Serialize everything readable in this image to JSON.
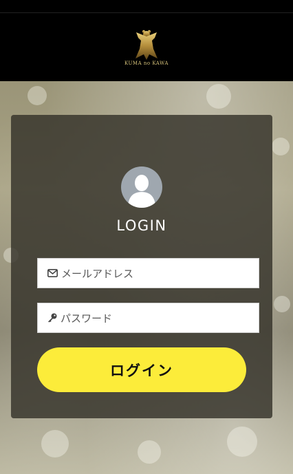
{
  "header": {
    "logo_text": "KUMA no KAWA"
  },
  "login": {
    "title": "LOGIN",
    "email_placeholder": "メールアドレス",
    "password_placeholder": "パスワード",
    "submit_label": "ログイン"
  },
  "icons": {
    "email": "envelope-icon",
    "password": "key-icon",
    "avatar": "user-silhouette-icon"
  },
  "colors": {
    "header_bg": "#000000",
    "panel_bg": "#34322a",
    "button_bg": "#fcec3a",
    "logo_gold": "#c9a84c"
  }
}
